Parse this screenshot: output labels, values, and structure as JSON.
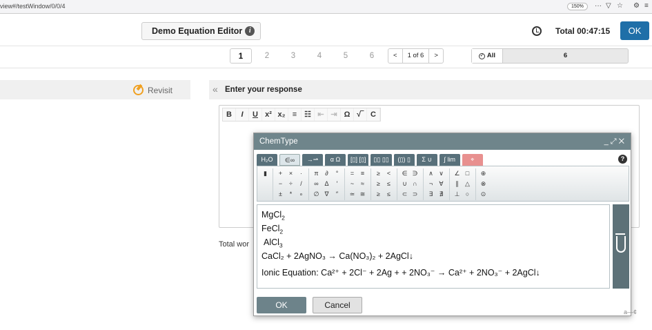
{
  "browser": {
    "url": "view#/testWindow/0/0/4",
    "zoom": "150%",
    "icons": [
      "more-icon",
      "pocket-icon",
      "star-icon",
      "extensions-icon",
      "menu-icon"
    ]
  },
  "header": {
    "title": "Demo Equation Editor",
    "timer": "Total 00:47:15",
    "ok_label": "OK"
  },
  "pagination": {
    "pages": [
      "1",
      "2",
      "3",
      "4",
      "5",
      "6"
    ],
    "current": "1",
    "prev": "<",
    "indicator": "1 of 6",
    "next": ">",
    "all_label": "All",
    "all_count": "6"
  },
  "left": {
    "revisit_label": "Revisit"
  },
  "response": {
    "label": "Enter your response",
    "total_words_label": "Total wor"
  },
  "toolbar": {
    "bold": "B",
    "italic": "I",
    "underline": "U",
    "superscript": "x²",
    "subscript": "x₂",
    "ordered_list": "≡",
    "bullet_list": "☷",
    "outdent": "⇤",
    "indent": "⇥",
    "omega": "Ω",
    "sqrt": "√‾",
    "clear": "C"
  },
  "chemtype": {
    "title": "ChemType",
    "tabs": [
      "H₂O",
      "∈∞",
      "→⇀",
      "α Ω",
      "[▯] [▯]",
      "▯▯ ▯▯",
      "(▯) ▯",
      "Σ ∪",
      "∫ lim",
      "⌖"
    ],
    "help": "?",
    "ok_label": "OK",
    "cancel_label": "Cancel",
    "lines": [
      {
        "parts": [
          "MgCl",
          "2"
        ]
      },
      {
        "parts": [
          "FeCl",
          "2"
        ]
      },
      {
        "parts": [
          "AlCl",
          "3"
        ]
      },
      {
        "text": "CaCl₂ + 2AgNO₃ → Ca(NO₃)₂ + 2AgCl↓"
      },
      {
        "text": "Ionic Equation: Ca²⁺ + 2Cl⁻ + 2Ag + + 2NO₃⁻ → Ca²⁺ + 2NO₃⁻ + 2AgCl↓"
      }
    ]
  },
  "palette": {
    "c1": [
      "▮"
    ],
    "c2": [
      "+",
      "×",
      "·",
      "−",
      "÷",
      "/",
      "±",
      "*",
      "∘"
    ],
    "c3": [
      "π",
      "∂",
      "°",
      "∞",
      "Δ",
      "′",
      "∅",
      "∇",
      "″"
    ],
    "c4": [
      "=",
      "≡",
      "~",
      "≈",
      "≃",
      "≅"
    ],
    "c5": [
      "≥",
      "<",
      "≥",
      "≤",
      "≥",
      "≤"
    ],
    "c6": [
      "∈",
      "∋",
      "∪",
      "∩",
      "⊂",
      "⊃"
    ],
    "c7": [
      "∧",
      "∨",
      "¬",
      "∀",
      "∃",
      "∄"
    ],
    "c8": [
      "∠",
      "□",
      "∥",
      "△",
      "⊥",
      "○"
    ],
    "c9": [
      "⊕",
      "⊗",
      "⊙"
    ]
  }
}
